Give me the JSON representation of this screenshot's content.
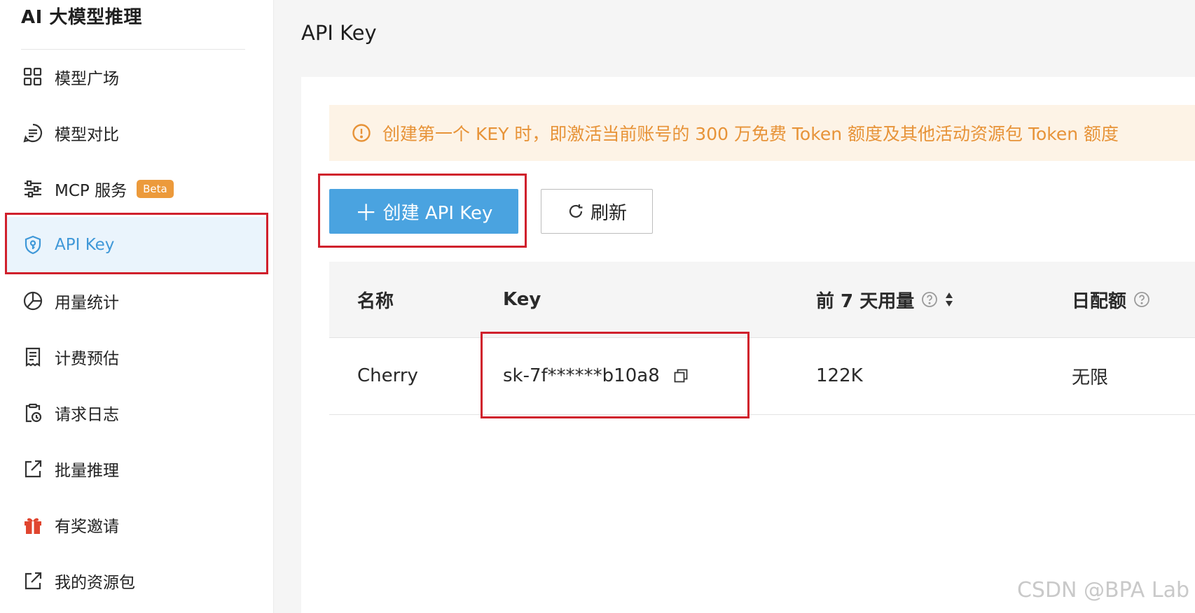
{
  "sidebar": {
    "title": "AI 大模型推理",
    "items": [
      {
        "label": "模型广场",
        "icon": "grid-icon"
      },
      {
        "label": "模型对比",
        "icon": "chat-list-icon"
      },
      {
        "label": "MCP 服务",
        "icon": "sliders-icon",
        "badge": "Beta"
      },
      {
        "label": "API Key",
        "icon": "shield-key-icon",
        "active": true
      },
      {
        "label": "用量统计",
        "icon": "pie-chart-icon"
      },
      {
        "label": "计费预估",
        "icon": "receipt-icon"
      },
      {
        "label": "请求日志",
        "icon": "clipboard-clock-icon"
      },
      {
        "label": "批量推理",
        "icon": "export-icon"
      },
      {
        "label": "有奖邀请",
        "icon": "gift-icon"
      },
      {
        "label": "我的资源包",
        "icon": "export-icon"
      }
    ]
  },
  "main": {
    "title": "API Key",
    "notice": "创建第一个 KEY 时，即激活当前账号的 300 万免费 Token 额度及其他活动资源包 Token 额度",
    "create_button": "创建 API Key",
    "refresh_button": "刷新",
    "table": {
      "columns": [
        "名称",
        "Key",
        "前 7 天用量",
        "日配额"
      ],
      "rows": [
        {
          "name": "Cherry",
          "key": "sk-7f******b10a8",
          "usage": "122K",
          "quota": "无限"
        }
      ]
    }
  },
  "watermark": "CSDN @BPA Lab",
  "colors": {
    "accent": "#4aa3e0",
    "active_bg": "#eaf4fc",
    "notice_text": "#e79338",
    "notice_bg": "#fdf3e6",
    "beta_badge": "#ec9a3b",
    "highlight_box": "#d0202c",
    "gift": "#e0452f"
  }
}
